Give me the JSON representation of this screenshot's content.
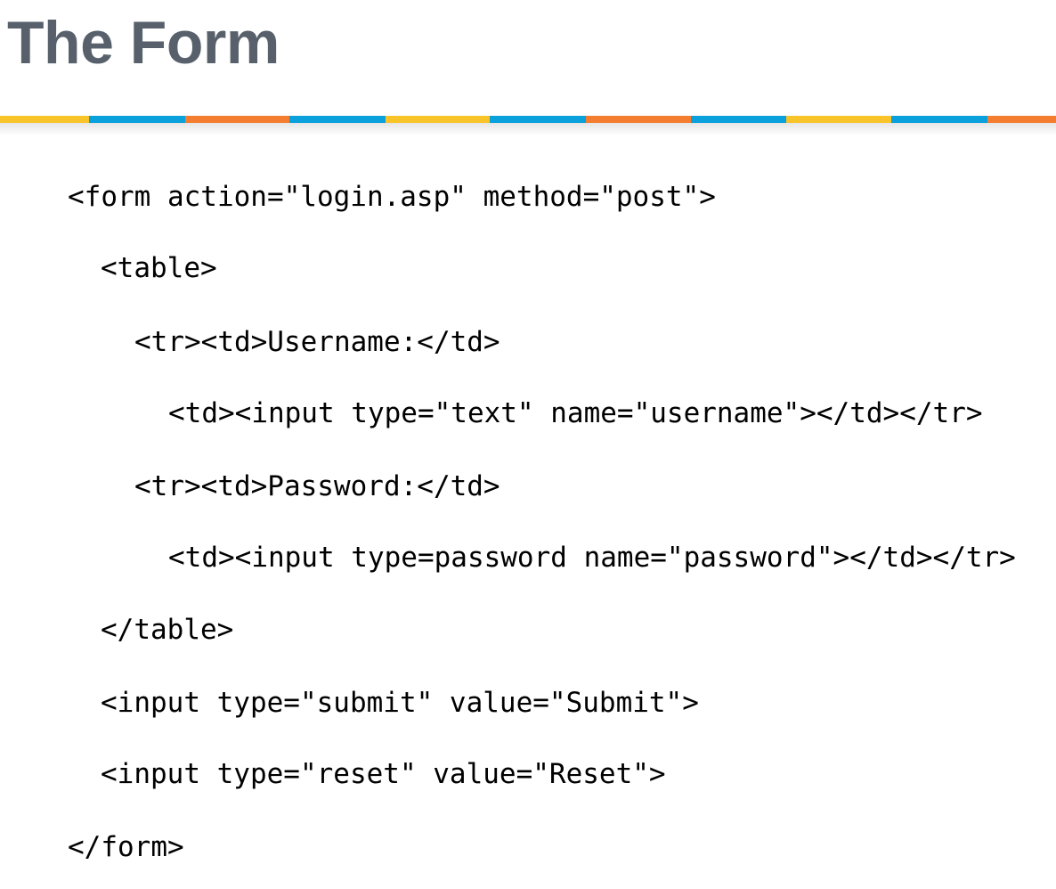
{
  "slide": {
    "title": "The Form",
    "title_color": "#58616b",
    "stripe_colors": [
      "#f9c32a",
      "#0aa0dc",
      "#f57d30",
      "#0aa0dc",
      "#f9c32a",
      "#0aa0dc",
      "#f57d30",
      "#0aa0dc",
      "#f9c32a",
      "#0aa0dc",
      "#f57d30"
    ]
  },
  "code": {
    "lines": [
      "<form action=\"login.asp\" method=\"post\">",
      "<table>",
      "<tr><td>Username:</td>",
      "<td><input type=\"text\" name=\"username\"></td></tr>",
      "<tr><td>Password:</td>",
      "<td><input type=password name=\"password\"></td></tr>",
      "</table>",
      "<input type=\"submit\" value=\"Submit\">",
      "<input type=\"reset\" value=\"Reset\">",
      "</form>"
    ]
  }
}
